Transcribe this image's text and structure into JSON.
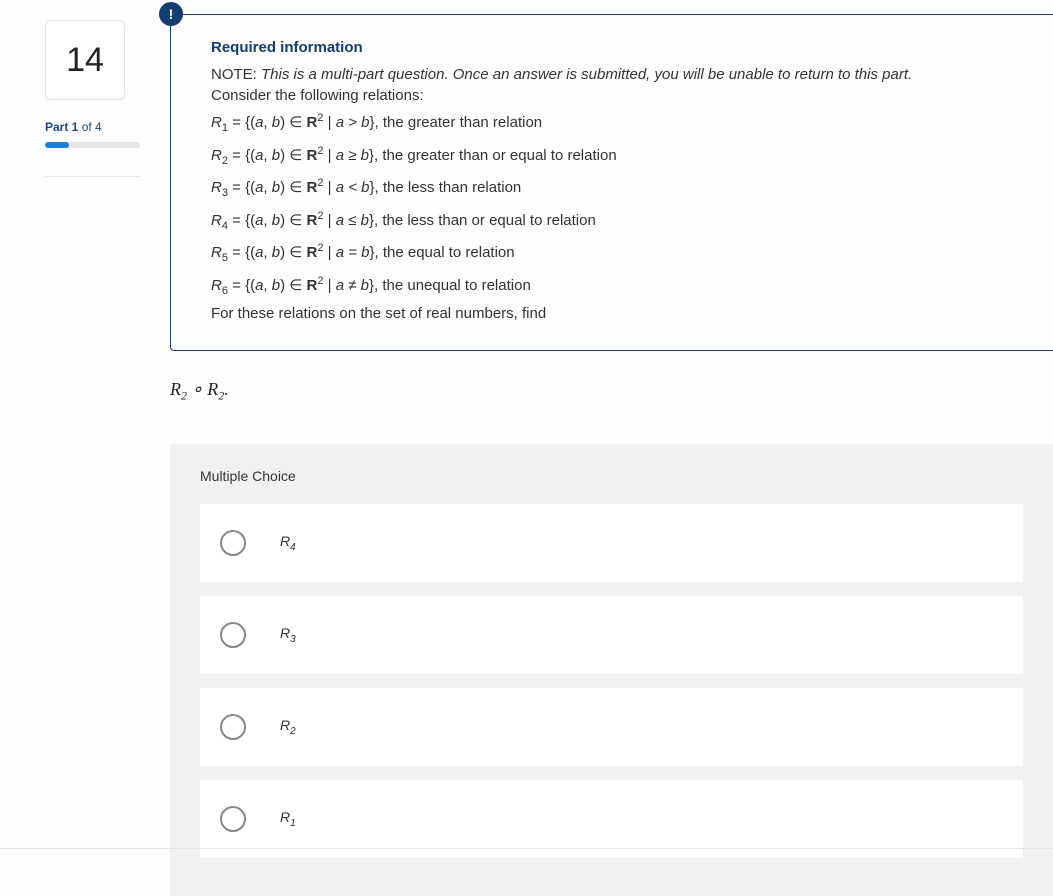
{
  "question_number": "14",
  "part": {
    "prefix": "Part 1",
    "suffix": " of 4",
    "progress_percent": 25
  },
  "info": {
    "badge": "!",
    "title": "Required information",
    "note_label": "NOTE: ",
    "note_text": "This is a multi-part question. Once an answer is submitted, you will be unable to return to this part.",
    "consider": "Consider the following relations:",
    "relations": [
      {
        "name": "R",
        "idx": "1",
        "cond": "a > b",
        "desc": ", the greater than relation"
      },
      {
        "name": "R",
        "idx": "2",
        "cond": "a ≥ b",
        "desc": ", the greater than or equal to relation"
      },
      {
        "name": "R",
        "idx": "3",
        "cond": "a < b",
        "desc": ", the less than relation"
      },
      {
        "name": "R",
        "idx": "4",
        "cond": "a ≤ b",
        "desc": ", the less than or equal to relation"
      },
      {
        "name": "R",
        "idx": "5",
        "cond": "a = b",
        "desc": ", the equal to relation"
      },
      {
        "name": "R",
        "idx": "6",
        "cond": "a ≠ b",
        "desc": ", the unequal to relation"
      }
    ],
    "footer": "For these relations on the set of real numbers, find"
  },
  "prompt": {
    "left": "R",
    "lidx": "2",
    "op": " ∘ ",
    "right": "R",
    "ridx": "2",
    "end": "."
  },
  "mc": {
    "heading": "Multiple Choice",
    "options": [
      {
        "r": "R",
        "i": "4"
      },
      {
        "r": "R",
        "i": "3"
      },
      {
        "r": "R",
        "i": "2"
      },
      {
        "r": "R",
        "i": "1"
      }
    ]
  }
}
